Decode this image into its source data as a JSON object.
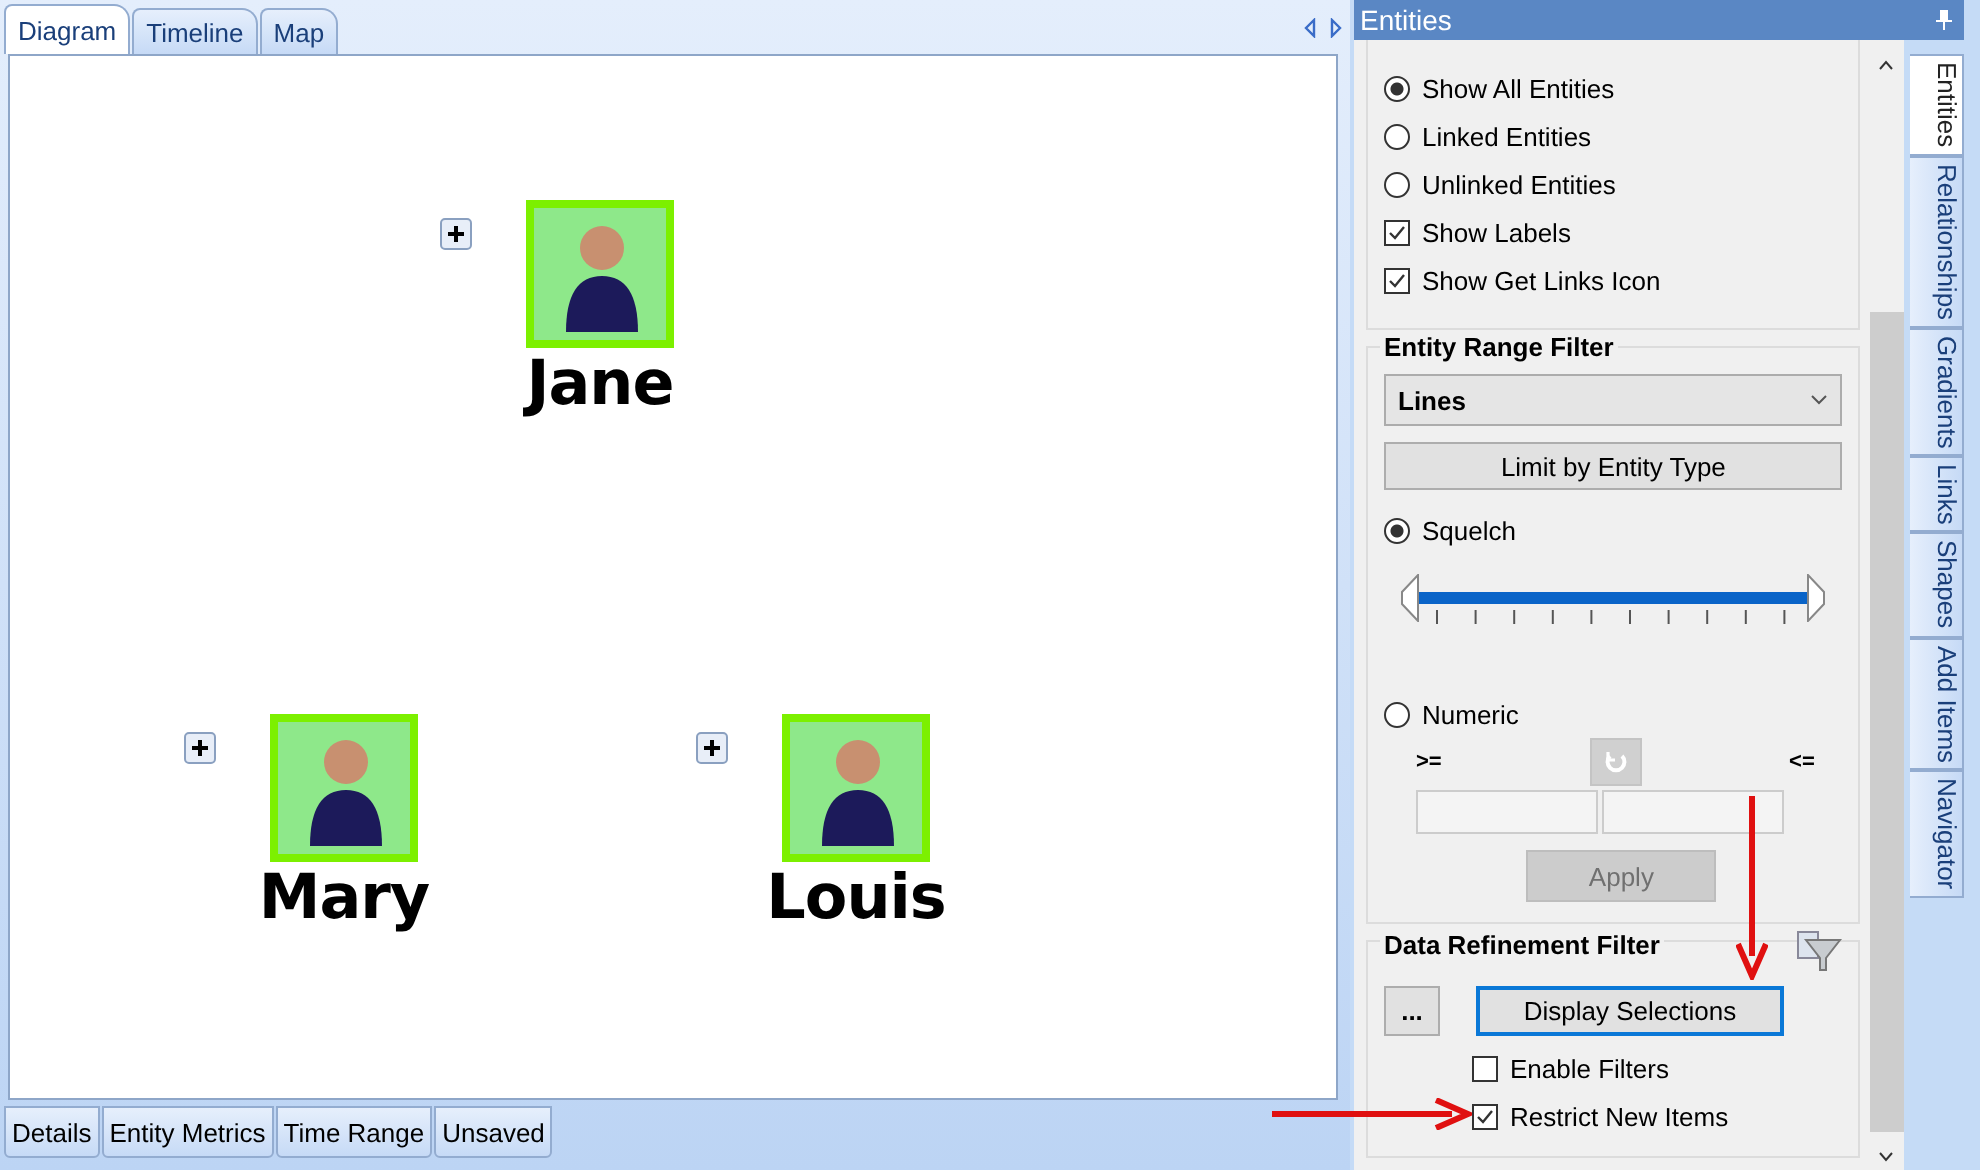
{
  "diagram_tabs": [
    {
      "label": "Diagram",
      "selected": true
    },
    {
      "label": "Timeline",
      "selected": false
    },
    {
      "label": "Map",
      "selected": false
    }
  ],
  "entities": [
    {
      "name": "Jane",
      "selected": true
    },
    {
      "name": "Mary",
      "selected": true
    },
    {
      "name": "Louis",
      "selected": true
    }
  ],
  "bottom_tabs": [
    {
      "label": "Details",
      "selected": false
    },
    {
      "label": "Entity Metrics",
      "selected": false
    },
    {
      "label": "Time Range",
      "selected": false
    },
    {
      "label": "Unsaved",
      "selected": false
    }
  ],
  "panel": {
    "title": "Entities"
  },
  "show_hide": {
    "options": [
      {
        "kind": "radio",
        "label": "Show All Entities",
        "checked": true
      },
      {
        "kind": "radio",
        "label": "Linked Entities",
        "checked": false
      },
      {
        "kind": "radio",
        "label": "Unlinked Entities",
        "checked": false
      },
      {
        "kind": "checkbox",
        "label": "Show Labels",
        "checked": true
      },
      {
        "kind": "checkbox",
        "label": "Show Get Links Icon",
        "checked": true
      }
    ]
  },
  "range_filter": {
    "title": "Entity Range Filter",
    "dropdown": {
      "value": "Lines"
    },
    "limit_button": "Limit by Entity Type",
    "squelch": {
      "label": "Squelch",
      "selected": true
    },
    "slider": {
      "level": 1
    },
    "numeric": {
      "label": "Numeric",
      "selected": false
    },
    "min_label": ">=",
    "max_label": "<=",
    "apply_button": {
      "label": "Apply",
      "disabled": true
    }
  },
  "refinement": {
    "title": "Data Refinement Filter",
    "more_button": "...",
    "display_button": "Display Selections",
    "options": [
      {
        "label": "Enable Filters",
        "checked": false
      },
      {
        "label": "Restrict New Items",
        "checked": true
      }
    ]
  },
  "side_tabs": [
    {
      "label": "Entities",
      "selected": true
    },
    {
      "label": "Relationships",
      "selected": false
    },
    {
      "label": "Gradients",
      "selected": false
    },
    {
      "label": "Links",
      "selected": false
    },
    {
      "label": "Shapes",
      "selected": false
    },
    {
      "label": "Add Items",
      "selected": false
    },
    {
      "label": "Navigator",
      "selected": false
    }
  ]
}
